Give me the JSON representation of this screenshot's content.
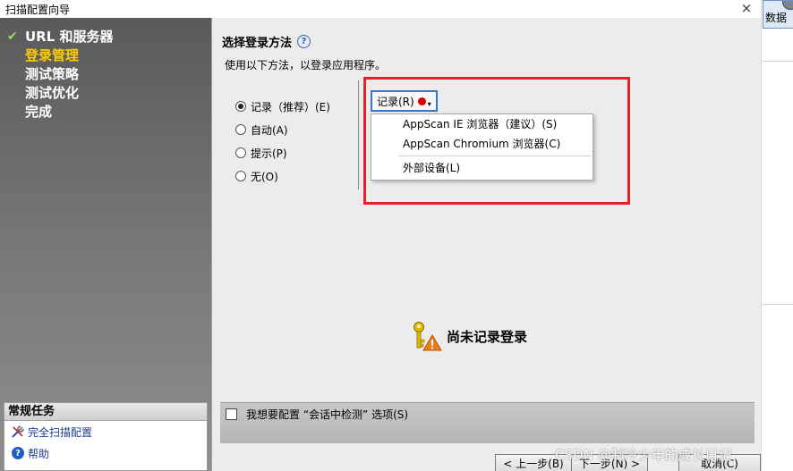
{
  "window": {
    "title": "扫描配置向导",
    "close_label": "×"
  },
  "background_window": {
    "toolbar_button_label": "数据"
  },
  "sidebar": {
    "steps": [
      {
        "mark": "✔",
        "label": "URL 和服务器"
      },
      {
        "mark": "",
        "label": "登录管理"
      },
      {
        "mark": "",
        "label": "测试策略"
      },
      {
        "mark": "",
        "label": "测试优化"
      },
      {
        "mark": "",
        "label": "完成"
      }
    ],
    "tasks": {
      "header": "常规任务",
      "items": [
        {
          "label": "完全扫描配置",
          "icon": "tools-icon"
        },
        {
          "label": "帮助",
          "icon": "help-icon"
        }
      ]
    }
  },
  "main": {
    "section_title": "选择登录方法",
    "help_glyph": "?",
    "description": "使用以下方法，以登录应用程序。",
    "radios": [
      {
        "label": "记录（推荐）(E)",
        "selected": true
      },
      {
        "label": "自动(A)",
        "selected": false
      },
      {
        "label": "提示(P)",
        "selected": false
      },
      {
        "label": "无(O)",
        "selected": false
      }
    ],
    "record_button": {
      "label": "记录(R)",
      "caret": "▾"
    },
    "dropdown_menu": {
      "items": [
        "AppScan IE 浏览器（建议）(S)",
        "AppScan Chromium 浏览器(C)",
        "外部设备(L)"
      ]
    },
    "status_text": "尚未记录登录",
    "session_option_label": "我想要配置 “会话中检测” 选项(S)",
    "nav": {
      "prev": "< 上一步(B)",
      "next": "下一步(N) >",
      "cancel": "取消(C)"
    }
  },
  "watermark": "CSDN @制冷少年的成长日记",
  "colors": {
    "highlight": "#e8202a",
    "current_step": "#ffcc00",
    "check": "#9ed65b",
    "record_dot": "#d40000"
  }
}
